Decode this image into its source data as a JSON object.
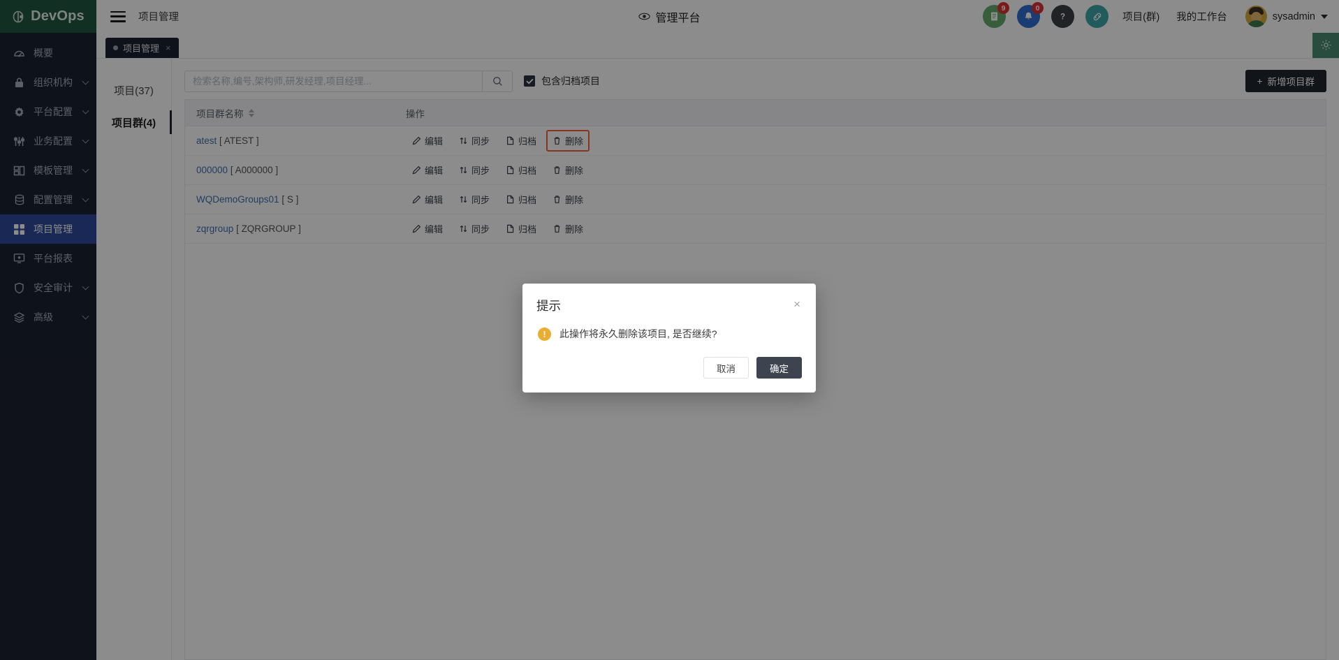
{
  "header": {
    "brand": "DevOps",
    "brand_icon": "devops-logo-icon",
    "menu_icon": "hamburger-menu-icon",
    "breadcrumb": "项目管理",
    "center_icon": "eye-icon",
    "center_title": "管理平台",
    "icons": [
      {
        "name": "document-icon",
        "glyph": "☰",
        "badge": "9",
        "color": "#63ab6b"
      },
      {
        "name": "bell-icon",
        "glyph": "✉",
        "badge": "0",
        "color": "#2f6fd0"
      },
      {
        "name": "help-icon",
        "glyph": "?",
        "badge": "",
        "color": "#3c3f44"
      },
      {
        "name": "link-icon",
        "glyph": "⚭",
        "badge": "",
        "color": "#3fa6a6"
      }
    ],
    "links": [
      "项目(群)",
      "我的工作台"
    ],
    "user": "sysadmin"
  },
  "sidebar": {
    "items": [
      {
        "label": "概要",
        "icon": "dashboard-icon",
        "expandable": false,
        "active": false
      },
      {
        "label": "组织机构",
        "icon": "lock-icon",
        "expandable": true,
        "active": false
      },
      {
        "label": "平台配置",
        "icon": "gear-icon",
        "expandable": true,
        "active": false
      },
      {
        "label": "业务配置",
        "icon": "sliders-icon",
        "expandable": true,
        "active": false
      },
      {
        "label": "模板管理",
        "icon": "template-icon",
        "expandable": true,
        "active": false
      },
      {
        "label": "配置管理",
        "icon": "database-icon",
        "expandable": true,
        "active": false
      },
      {
        "label": "项目管理",
        "icon": "grid-icon",
        "expandable": false,
        "active": true
      },
      {
        "label": "平台报表",
        "icon": "monitor-icon",
        "expandable": false,
        "active": false
      },
      {
        "label": "安全审计",
        "icon": "shield-icon",
        "expandable": true,
        "active": false
      },
      {
        "label": "高级",
        "icon": "layers-icon",
        "expandable": true,
        "active": false
      }
    ]
  },
  "tabstrip": {
    "tab_label": "项目管理",
    "close_glyph": "×",
    "gear_icon": "settings-gear-icon"
  },
  "left_tabs": [
    {
      "label": "项目(37)",
      "active": false
    },
    {
      "label": "项目群(4)",
      "active": true
    }
  ],
  "toolbar": {
    "search_placeholder": "检索名称,编号,架构师,研发经理,项目经理...",
    "search_value": "",
    "search_icon": "search-icon",
    "checkbox_label": "包含归档项目",
    "checkbox_checked": true,
    "add_button": "新增项目群",
    "add_icon": "plus-icon"
  },
  "table": {
    "columns": [
      "项目群名称",
      "操作"
    ],
    "sort_icon": "sort-arrows-icon",
    "ops": [
      {
        "label": "编辑",
        "icon": "pencil-icon"
      },
      {
        "label": "同步",
        "icon": "sync-icon"
      },
      {
        "label": "归档",
        "icon": "archive-icon"
      },
      {
        "label": "删除",
        "icon": "trash-icon"
      }
    ],
    "rows": [
      {
        "name": "atest",
        "code": "[ ATEST ]",
        "focused_op": "删除"
      },
      {
        "name": "000000",
        "code": "[ A000000 ]",
        "focused_op": ""
      },
      {
        "name": "WQDemoGroups01",
        "code": "[ S ]",
        "focused_op": ""
      },
      {
        "name": "zqrgroup",
        "code": "[ ZQRGROUP ]",
        "focused_op": ""
      }
    ]
  },
  "modal": {
    "title": "提示",
    "close_glyph": "×",
    "warn_glyph": "!",
    "message": "此操作将永久删除该项目, 是否继续?",
    "cancel": "取消",
    "confirm": "确定"
  },
  "colors": {
    "brand_green": "#1f5741",
    "sidebar_bg": "#1b2130",
    "sidebar_active": "#2f4a9a",
    "focus_outline": "#f0603a",
    "warn": "#e8ad31",
    "link": "#3f6fb0",
    "badge_red": "#e03131"
  }
}
